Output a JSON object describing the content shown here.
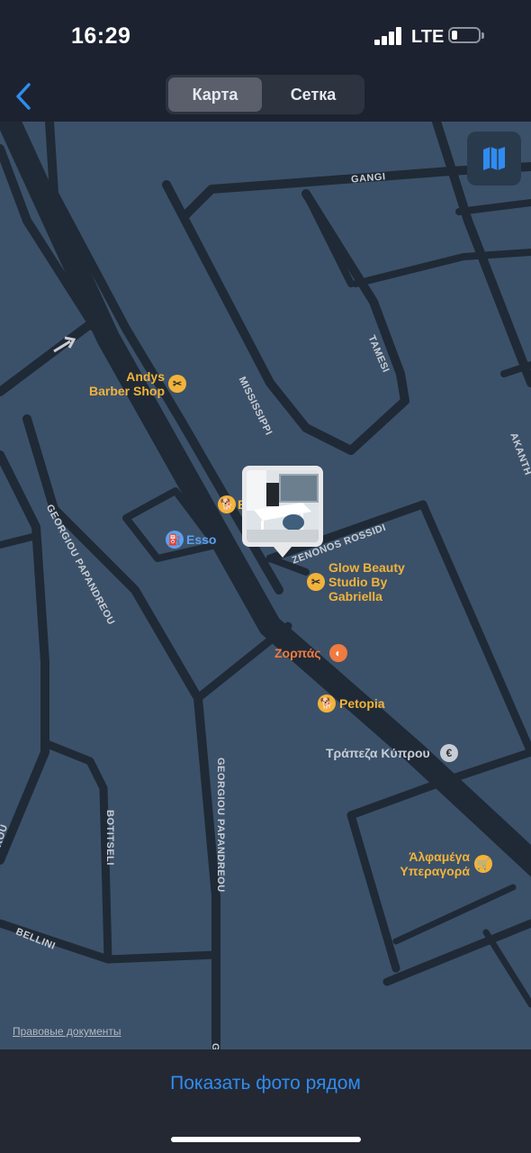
{
  "status_bar": {
    "time": "16:29",
    "network": "LTE"
  },
  "nav": {
    "tabs": [
      "Карта",
      "Сетка"
    ],
    "selected": "Карта"
  },
  "map": {
    "roads": [
      "GANGI",
      "MISSISSIPPI",
      "TAMESI",
      "AKANTH",
      "ZENONOS ROSSIDI",
      "GEORGIOU PAPANDREOU",
      "GEORGIOU PAPANDREOU",
      "BOTITSELI",
      "BELLINI",
      "VIKOU",
      "GE"
    ],
    "pois": {
      "andys_barber": [
        "Andys",
        "Barber Shop"
      ],
      "esso": "Esso",
      "pet_partial": "E",
      "glow_beauty": [
        "Glow Beauty",
        "Studio By",
        "Gabriella"
      ],
      "zorpas": "Ζορπάς",
      "petopia": "Petopia",
      "bank": "Τράπεζα Κύπρου",
      "alphamega": [
        "Άλφαμέγα",
        "Υπεραγορά"
      ]
    },
    "legal": "Правовые документы",
    "colors": {
      "poi_yellow": "#f2b33a",
      "poi_orange": "#f07b3f",
      "poi_blue": "#5aa0f0",
      "poi_gray": "#c8ccd4"
    }
  },
  "bottom": {
    "show_photos_label": "Показать фото рядом"
  }
}
